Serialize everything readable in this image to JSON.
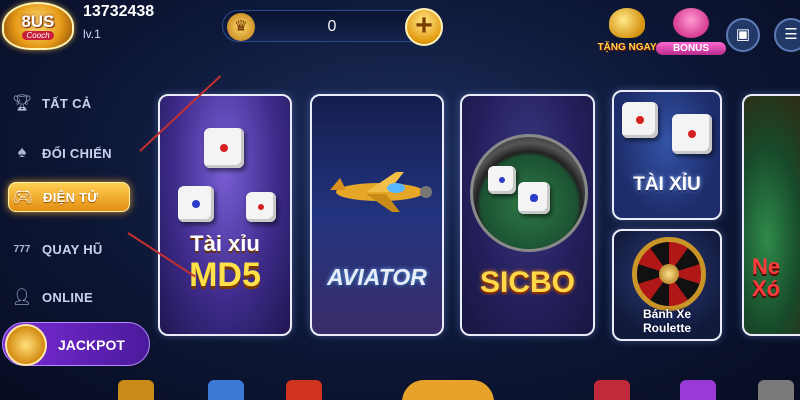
{
  "header": {
    "logo_text": "8US",
    "logo_sub": "Cooch",
    "user_id": "13732438",
    "user_level": "lv.1",
    "balance": "0",
    "rewards": [
      {
        "label": "TẶNG NGAY",
        "icon": "gold-coins-icon"
      },
      {
        "label": "BONUS",
        "icon": "piggy-bank-icon"
      }
    ],
    "buttons": [
      {
        "icon": "briefcase-icon"
      },
      {
        "icon": "menu-list-icon"
      }
    ]
  },
  "sidebar": {
    "items": [
      {
        "label": "TẤT CẢ",
        "icon": "trophy-icon",
        "active": false
      },
      {
        "label": "ĐỐI CHIẾN",
        "icon": "cards-icon",
        "active": false
      },
      {
        "label": "ĐIỆN TỬ",
        "icon": "gamepad-icon",
        "active": true
      },
      {
        "label": "QUAY HŨ",
        "icon": "slot-777-icon",
        "active": false
      },
      {
        "label": "ONLINE",
        "icon": "user-icon",
        "active": false
      }
    ],
    "jackpot_label": "JACKPOT"
  },
  "games": [
    {
      "line1": "Tài xỉu",
      "line2": "MD5"
    },
    {
      "line1": "AVIATOR"
    },
    {
      "line1": "SICBO"
    },
    {
      "line1": "TÀI XỈU"
    },
    {
      "line1": "Bánh Xe",
      "line2": "Roulette"
    },
    {
      "line1": "Ne",
      "line2": "Xó"
    }
  ],
  "colors": {
    "accent": "#f0a21e",
    "background": "#0d1736",
    "annotation_arrow": "#c23030"
  }
}
